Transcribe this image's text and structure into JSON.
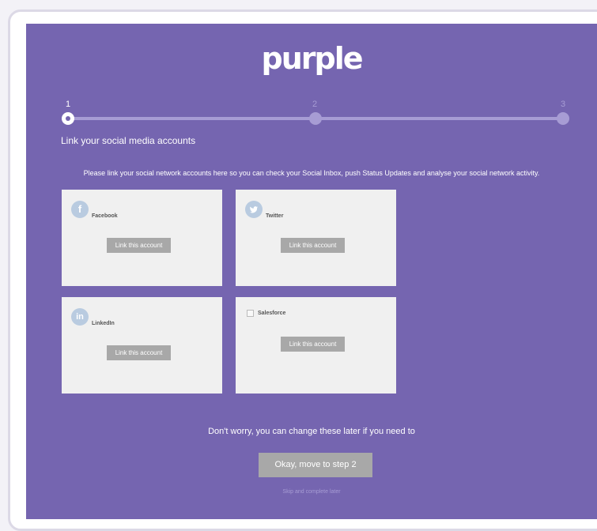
{
  "brand": {
    "logo_text": "purple"
  },
  "stepper": {
    "steps": [
      {
        "number": "1",
        "active": true
      },
      {
        "number": "2",
        "active": false
      },
      {
        "number": "3",
        "active": false
      }
    ]
  },
  "step_title": "Link your social media accounts",
  "intro": "Please link your social network accounts here so you can check your Social Inbox, push Status Updates and analyse your social network activity.",
  "accounts": [
    {
      "name": "Facebook",
      "icon": "facebook-icon",
      "button": "Link this account"
    },
    {
      "name": "Twitter",
      "icon": "twitter-icon",
      "button": "Link this account"
    },
    {
      "name": "LinkedIn",
      "icon": "linkedin-icon",
      "button": "Link this account"
    },
    {
      "name": "Salesforce",
      "icon": "broken-image-icon",
      "button": "Link this account"
    }
  ],
  "footer": {
    "reassure": "Don't worry, you can change these later if you need to",
    "next_button": "Okay, move to step 2",
    "skip_link": "Skip and complete later"
  },
  "colors": {
    "panel": "#7565b0",
    "track": "#a79cd4",
    "card": "#f0f0f0",
    "button": "#a8a8a8"
  }
}
